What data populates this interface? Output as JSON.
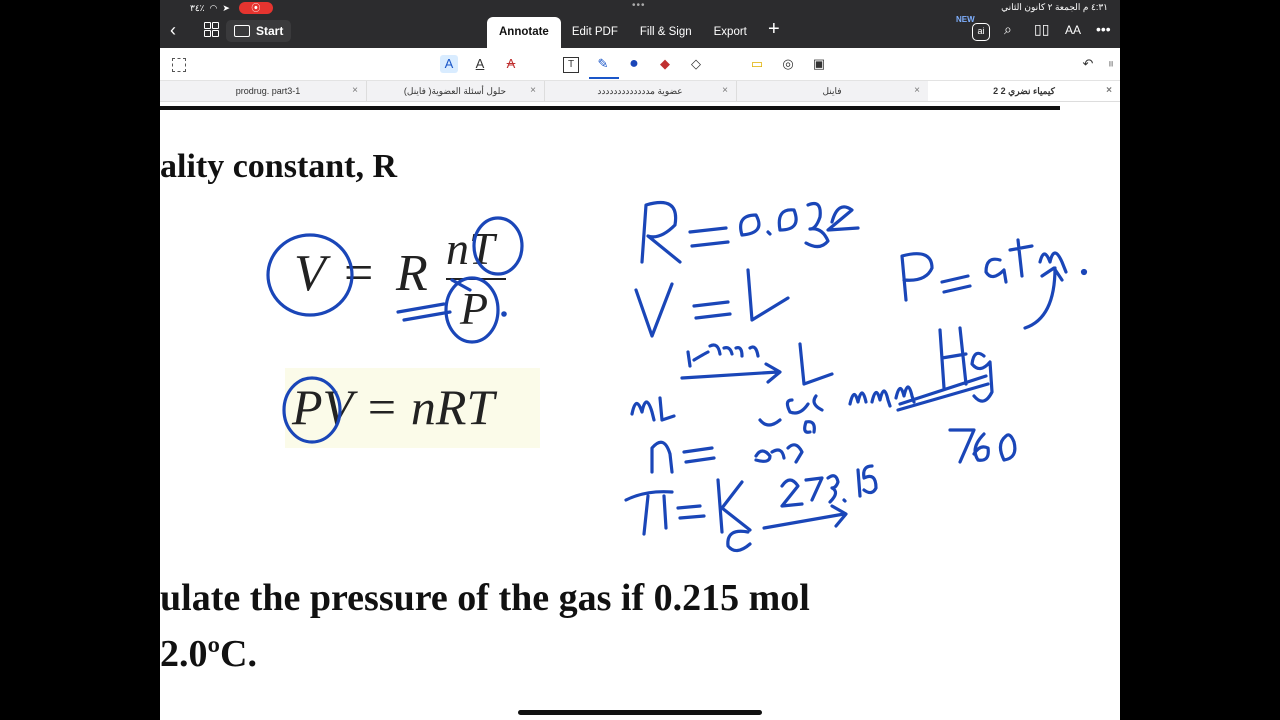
{
  "status": {
    "battery": "٣٤٪",
    "datetime": "٤:٣١ م  الجمعة ٢ كانون الثاني",
    "rec": "⦿"
  },
  "topbar": {
    "start_label": "Start",
    "tabs": [
      "Annotate",
      "Edit PDF",
      "Fill & Sign",
      "Export"
    ],
    "active_tab": "Annotate",
    "new_badge": "NEW"
  },
  "doc_tabs": [
    {
      "title": "prodrug. part3-1"
    },
    {
      "title": "حلول أسئلة العضوية( فاينل)"
    },
    {
      "title": "عضوية مددددددددددددد"
    },
    {
      "title": "فاينل"
    },
    {
      "title": "2 كيمياء نضري 2",
      "active": true
    }
  ],
  "slide": {
    "heading": "ality constant, R",
    "eq1_left": "V",
    "eq1_eq": "=",
    "eq1_R": "R",
    "eq1_num": "nT",
    "eq1_den": "P",
    "eq2": "PV = nRT",
    "question_line1": "ulate the pressure of the gas if 0.215 mol",
    "question_line2": "2.0ºC."
  },
  "handwriting": {
    "ink_color": "#1a46b8",
    "notes": [
      "R=0.082",
      "V=L",
      "P= atm",
      "ml ÷1000 → L",
      "mmHg",
      "760",
      "n= عدد مولات",
      "T=K",
      "C 273.15 →"
    ]
  }
}
